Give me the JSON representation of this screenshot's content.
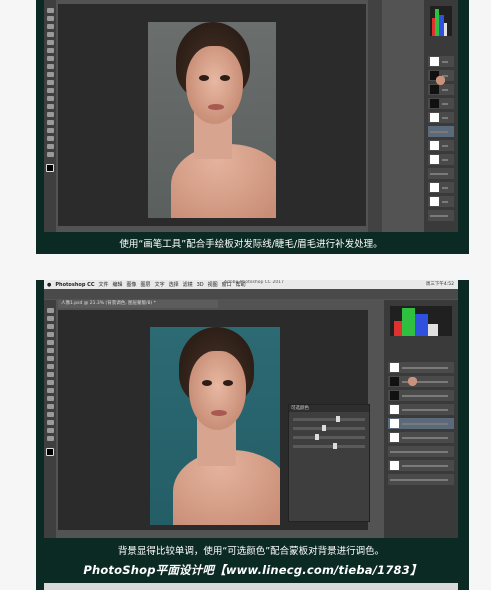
{
  "captions": {
    "first": "使用“画笔工具”配合手绘板对发际线/睫毛/眉毛进行补发处理。",
    "second": "背景显得比较单调，使用“可选颜色”配合蒙板对背景进行调色。"
  },
  "brand": {
    "text": "PhotoShop平面设计吧【www.linecg.com/tieba/1783】"
  },
  "screenshot2": {
    "menubar": {
      "app": "Photoshop CC",
      "items": [
        "文件",
        "编辑",
        "图像",
        "图层",
        "文字",
        "选择",
        "滤镜",
        "3D",
        "视图",
        "窗口",
        "帮助"
      ]
    },
    "window_title": "Adobe Photoshop CC 2017",
    "clock": "周三下午4:52",
    "tab": "人像1.psd @ 21.3% (背景调色, 图层蒙版/8) *",
    "dialog_title": "可选颜色"
  },
  "colors": {
    "frame": "#0c2a24",
    "background_before": "#5f6563",
    "background_after": "#2a6670"
  }
}
